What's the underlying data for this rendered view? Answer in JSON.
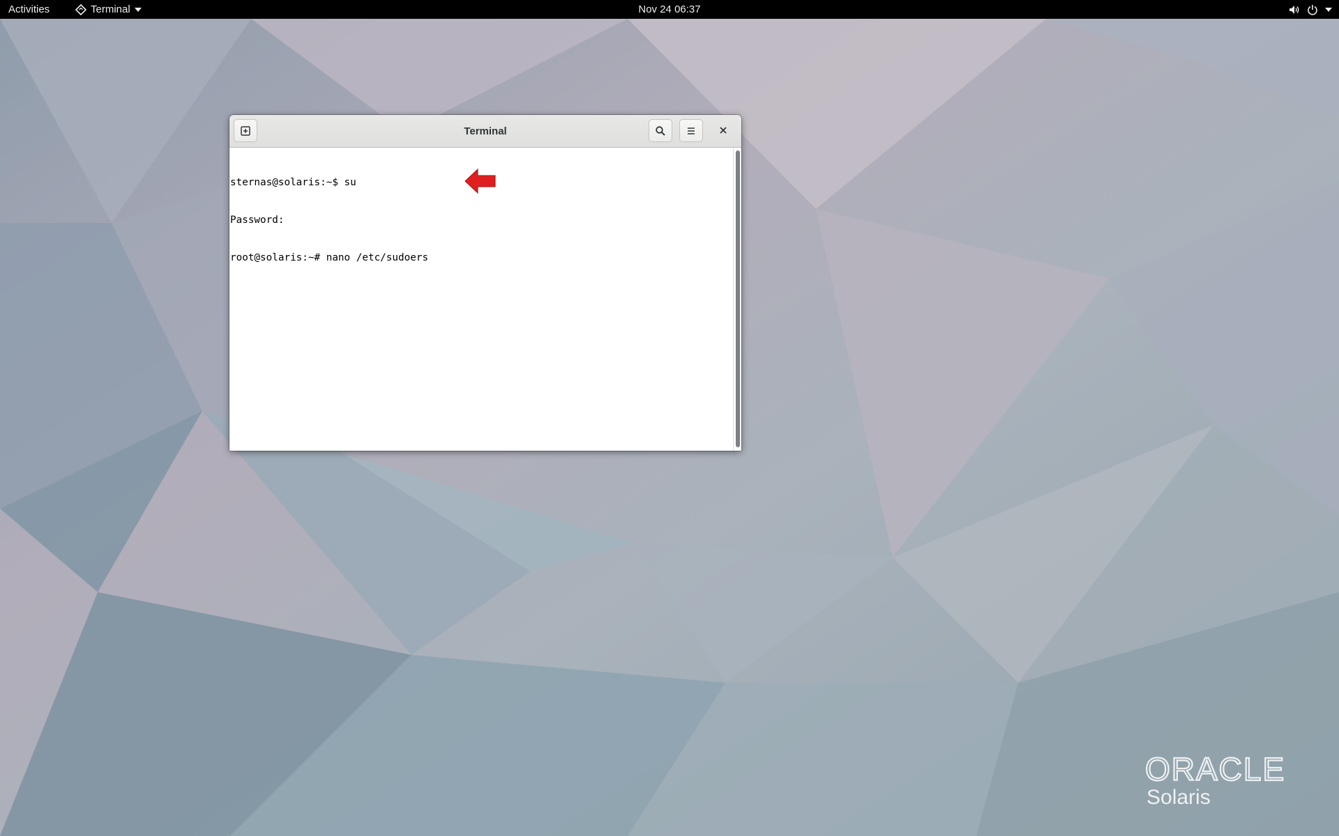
{
  "topbar": {
    "activities": "Activities",
    "app_menu": "Terminal",
    "clock": "Nov 24  06:37"
  },
  "window": {
    "title": "Terminal"
  },
  "terminal": {
    "lines": [
      "sternas@solaris:~$ su",
      "Password:",
      "root@solaris:~# nano /etc/sudoers"
    ]
  },
  "branding": {
    "logo_top": "ORACLE",
    "logo_bottom": "Solaris"
  },
  "colors": {
    "topbar": "#000000",
    "arrow": "#e02020",
    "logo": "#ffffff"
  }
}
